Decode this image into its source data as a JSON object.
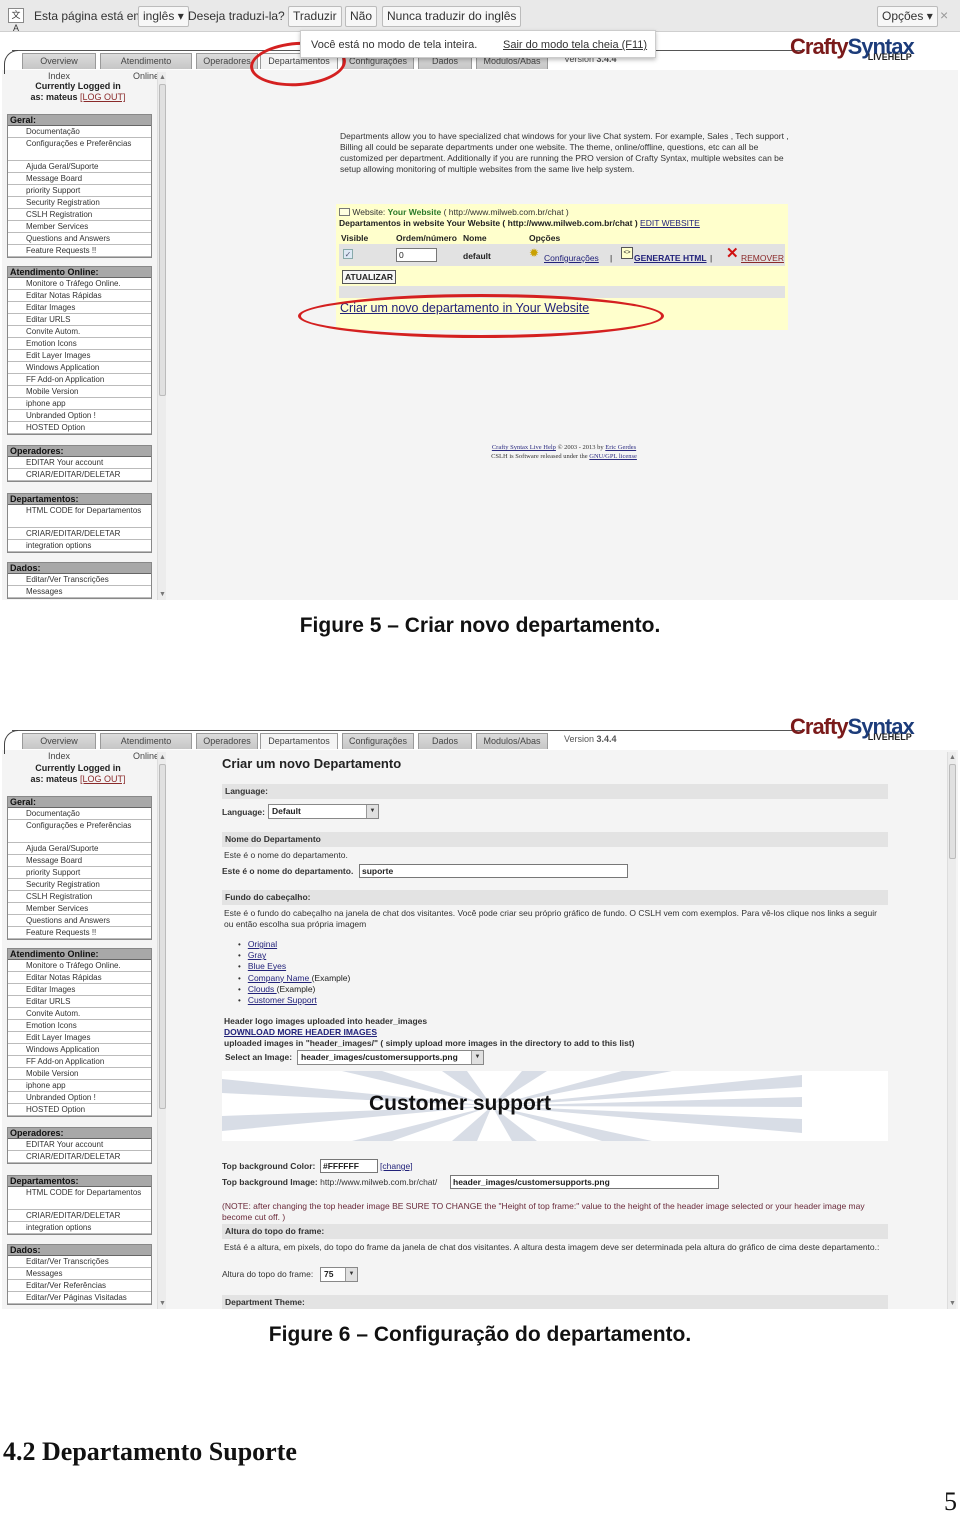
{
  "translate_bar": {
    "icon": "translate-icon",
    "prefix": "Esta página está em",
    "language": "inglês",
    "question": "Deseja traduzi-la?",
    "translate_button": "Traduzir",
    "no_button": "Não",
    "never_button": "Nunca traduzir do inglês",
    "options_button": "Opções",
    "close_icon": "×"
  },
  "fullscreen_notice": {
    "message": "Você está no modo de tela inteira.",
    "exit_link": "Sair do modo tela cheia (F11)"
  },
  "app": {
    "tabs": [
      "Overview Index",
      "Atendimento Online",
      "Operadores",
      "Departamentos",
      "Configurações",
      "Dados",
      "Modulos/Abas"
    ],
    "active_tab": "Departamentos",
    "version_label": "Version",
    "version_number": "3.4.4",
    "logo_part1": "Crafty",
    "logo_part2": "Syntax",
    "logo_sub": "LIVEHELP"
  },
  "login": {
    "line1": "Currently Logged in",
    "line2": "as: mateus",
    "logout": "[LOG OUT]"
  },
  "sidebar": {
    "groups": [
      {
        "title": "Geral:",
        "items": [
          "Documentação",
          "Configurações e Preferências",
          "Ajuda Geral/Suporte",
          "Message Board",
          "priority Support",
          "Security Registration",
          "CSLH Registration",
          "Member Services",
          "Questions and Answers",
          "Feature Requests !!"
        ]
      },
      {
        "title": "Atendimento Online:",
        "items": [
          "Monitore o Tráfego Online.",
          "Editar Notas Rápidas",
          "Editar Images",
          "Editar URLS",
          "Convite Autom.",
          "Emotion Icons",
          "Edit Layer Images",
          "Windows Application",
          "FF Add-on Application",
          "Mobile Version",
          "iphone app",
          "Unbranded Option !",
          "HOSTED Option"
        ]
      },
      {
        "title": "Operadores:",
        "items": [
          "EDITAR Your account",
          "CRIAR/EDITAR/DELETAR"
        ]
      },
      {
        "title": "Departamentos:",
        "items": [
          "HTML CODE for Departamentos",
          "CRIAR/EDITAR/DELETAR",
          "integration options"
        ]
      },
      {
        "title": "Dados:",
        "items": [
          "Editar/Ver Transcrições",
          "Messages",
          "Editar/Ver Referências",
          "Editar/Ver Páginas Visitadas"
        ]
      }
    ]
  },
  "figure5": {
    "description": "Departments allow you to have specialized chat windows for your live Chat system. For example, Sales , Tech support , Billing all could be separate departments under one website. The theme, online/offline, questions, etc can all be customized per department. Additionally if you are running the PRO version of Crafty Syntax, multiple websites can be setup allowing monitoring of multiple websites from the same live help system.",
    "website_label": "Website:",
    "website_name": "Your Website",
    "website_url": "( http://www.milweb.com.br/chat )",
    "departments_line": "Departamentos in website Your Website ( http://www.milweb.com.br/chat )",
    "edit_website": "EDIT WEBSITE",
    "columns": [
      "Visible",
      "Ordem/número",
      "Nome",
      "Opções"
    ],
    "row": {
      "visible": true,
      "order": "0",
      "name": "default",
      "config_link": "Configurações",
      "generate_link": "GENERATE HTML",
      "remove_link": "REMOVER",
      "separator": "|"
    },
    "update_button": "ATUALIZAR",
    "create_link": "Criar um novo departamento in Your Website",
    "footer_line1_link1": "Crafty Syntax Live Help",
    "footer_line1_mid": "© 2003 - 2013 by",
    "footer_line1_link2": "Eric Gerdes",
    "footer_line2_text": "CSLH is Software released under the",
    "footer_line2_link": "GNU/GPL license",
    "caption": "Figure 5 – Criar novo departamento."
  },
  "figure6": {
    "title": "Criar um novo Departamento",
    "language_section": "Language:",
    "language_label": "Language:",
    "language_value": "Default",
    "name_section": "Nome do Departamento",
    "name_help": "Este é o nome do departamento.",
    "name_label": "Este é o nome do departamento.",
    "name_value": "suporte",
    "header_section": "Fundo do cabeçalho:",
    "header_help": "Este é o fundo do cabeçalho na janela de chat dos visitantes. Você pode criar seu próprio gráfico de fundo. O CSLH vem com exemplos. Para vê-los clique nos links a seguir ou então escolha sua própria imagem",
    "header_options": [
      {
        "link": "Original",
        "suffix": ""
      },
      {
        "link": "Gray",
        "suffix": ""
      },
      {
        "link": "Blue Eyes",
        "suffix": ""
      },
      {
        "link": "Company Name ",
        "suffix": "(Example)"
      },
      {
        "link": "Clouds ",
        "suffix": "(Example)"
      },
      {
        "link": "Customer Support",
        "suffix": ""
      }
    ],
    "uploaded_label": "Header logo images uploaded into header_images",
    "download_link": "DOWNLOAD MORE HEADER IMAGES",
    "uploaded_note": "uploaded images in \"header_images/\" ( simply upload more images in the directory to add to this list)",
    "select_label": "Select an Image:",
    "select_value": "header_images/customersupports.png",
    "banner_text": "Customer support",
    "bg_color_label": "Top background Color:",
    "bg_color_value": "#FFFFFF",
    "change_link": "[change]",
    "bg_image_label": "Top background Image:",
    "bg_image_prefix": "http://www.milweb.com.br/chat/",
    "bg_image_value": "header_images/customersupports.png",
    "note": "(NOTE: after changing the top header image BE SURE TO CHANGE the \"Height of top frame:\" value to the height of the header image selected or your header image may become cut off. )",
    "height_section": "Altura do topo do frame:",
    "height_help": "Está é a altura, em pixels, do topo do frame da janela de chat dos visitantes. A altura desta imagem deve ser determinada pela altura do gráfico de cima deste departamento.:",
    "height_label": "Altura do topo do frame:",
    "height_value": "75",
    "theme_section": "Department Theme:",
    "caption": "Figure 6 – Configuração do departamento."
  },
  "document": {
    "section_heading": "4.2 Departamento Suporte",
    "page_number": "5"
  },
  "colors": {
    "annotation_red": "#d42020",
    "highlight_yellow": "#ffffcc",
    "logo_red": "#7a1a1a",
    "logo_blue": "#1c3c7a"
  }
}
